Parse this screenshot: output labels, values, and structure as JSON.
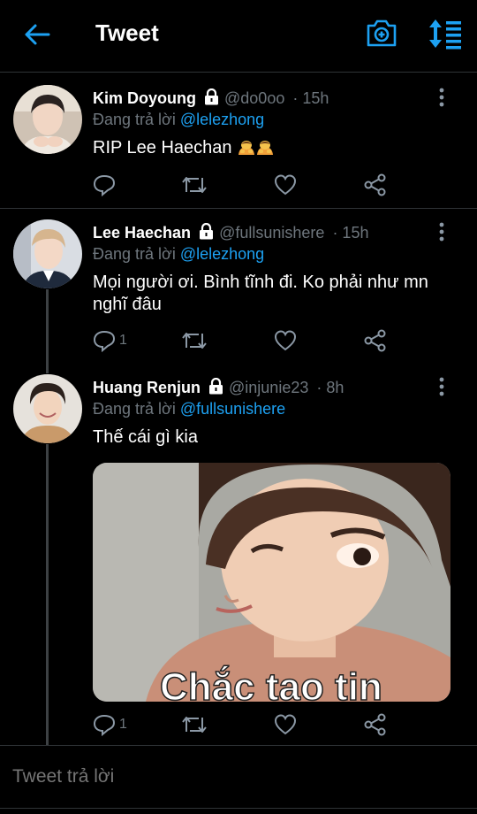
{
  "header": {
    "title": "Tweet",
    "back_icon": "arrow-left-icon",
    "camera_icon": "camera-plus-icon",
    "sort_icon": "sort-list-icon",
    "accent_color": "#1da1f2"
  },
  "tweets": [
    {
      "name": "Kim Doyoung",
      "handle": "@do0oo",
      "time": "· 15h",
      "reply_prefix": "Đang trả lời",
      "reply_to": "@lelezhong",
      "text": "RIP Lee Haechan",
      "emoji": "person-bowing-emoji",
      "reply_count": "",
      "protected": true
    },
    {
      "name": "Lee Haechan",
      "handle": "@fullsunishere",
      "time": "· 15h",
      "reply_prefix": "Đang trả lời",
      "reply_to": "@lelezhong",
      "text": "Mọi người ơi. Bình tĩnh đi. Ko phải như mn nghĩ đâu",
      "reply_count": "1",
      "protected": true
    },
    {
      "name": "Huang Renjun",
      "handle": "@injunie23",
      "time": "· 8h",
      "reply_prefix": "Đang trả lời",
      "reply_to": "@fullsunishere",
      "text": "Thế cái gì kia",
      "media_caption": "Chắc tao tin",
      "reply_count": "1",
      "protected": true
    }
  ],
  "compose": {
    "placeholder": "Tweet trả lời"
  }
}
